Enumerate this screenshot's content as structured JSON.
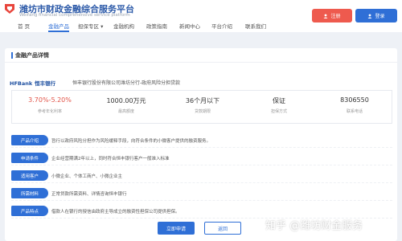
{
  "header": {
    "site_title": "潍坊市财政金融综合服务平台",
    "site_subtitle": "Weifang financial comprehensive service platform",
    "register_label": "注册",
    "login_label": "登录"
  },
  "nav": {
    "items": [
      {
        "label": "首 页"
      },
      {
        "label": "金融产品"
      },
      {
        "label": "担保专区 ▾"
      },
      {
        "label": "金融机构"
      },
      {
        "label": "政策指南"
      },
      {
        "label": "新闻中心"
      },
      {
        "label": "平台介绍"
      },
      {
        "label": "联系我们"
      }
    ],
    "active_index": 1
  },
  "panel": {
    "title": "金融产品详情",
    "bank_logo_en": "HFBank",
    "bank_logo_cn": "恒丰银行",
    "product_name": "恒丰银行股份有限公司潍坊分行-政府风险分担贷款"
  },
  "stats": [
    {
      "value": "3.70%-5.20%",
      "label": "参考年化利率",
      "highlight": true
    },
    {
      "value": "1000.00万元",
      "label": "最高额度",
      "highlight": false
    },
    {
      "value": "36个月以下",
      "label": "贷款期限",
      "highlight": false
    },
    {
      "value": "保证",
      "label": "担保方式",
      "highlight": false
    },
    {
      "value": "8306550",
      "label": "联系电话",
      "highlight": false
    }
  ],
  "details": [
    {
      "tag": "产品介绍",
      "text": "旨行以政府风险分担作为风险缓释手段，向符合条件的小微客户提供的融资服务。"
    },
    {
      "tag": "申请条件",
      "text": "企业经营期满2年以上，同时符合恒丰银行客户一般准入标准"
    },
    {
      "tag": "适用客户",
      "text": "小微企业、个体工商户、小微企业主"
    },
    {
      "tag": "所需材料",
      "text": "正常贷款所需资料、详情咨询恒丰银行"
    },
    {
      "tag": "产品特点",
      "text": "借款人在银行的授信由政府主导成立的融资性担保公司提供担保。"
    }
  ],
  "actions": {
    "apply_label": "立即申请",
    "back_label": "返回"
  },
  "watermark": "知乎 @潍坊财金服务",
  "colors": {
    "primary": "#2f6fd6",
    "register": "#ee5a4e",
    "rate": "#e25549"
  }
}
